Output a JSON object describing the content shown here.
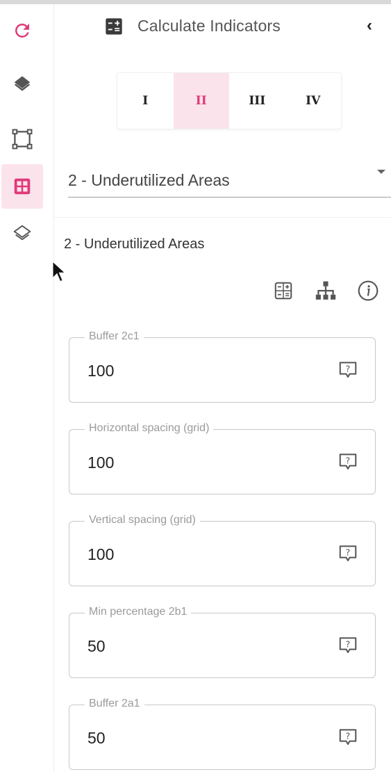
{
  "colors": {
    "accent": "#e03a78",
    "accent_bg": "#fbe3ec"
  },
  "rail": {
    "items": [
      {
        "icon": "refresh-icon"
      },
      {
        "icon": "layers-filled-icon"
      },
      {
        "icon": "polygon-select-icon"
      },
      {
        "icon": "calculator-grid-icon",
        "active": true
      },
      {
        "icon": "layers-outline-icon"
      }
    ]
  },
  "header": {
    "title": "Calculate Indicators",
    "collapse": "‹"
  },
  "tabs": [
    {
      "label": "I"
    },
    {
      "label": "II",
      "active": true
    },
    {
      "label": "III"
    },
    {
      "label": "IV"
    }
  ],
  "select": {
    "value": "2 - Underutilized Areas"
  },
  "section": {
    "title": "2 - Underutilized Areas",
    "tools": [
      "calculator-icon",
      "hierarchy-icon",
      "info-icon"
    ]
  },
  "fields": [
    {
      "label": "Buffer 2c1",
      "value": "100"
    },
    {
      "label": "Horizontal spacing (grid)",
      "value": "100"
    },
    {
      "label": "Vertical spacing (grid)",
      "value": "100"
    },
    {
      "label": "Min percentage 2b1",
      "value": "50"
    },
    {
      "label": "Buffer 2a1",
      "value": "50"
    }
  ]
}
